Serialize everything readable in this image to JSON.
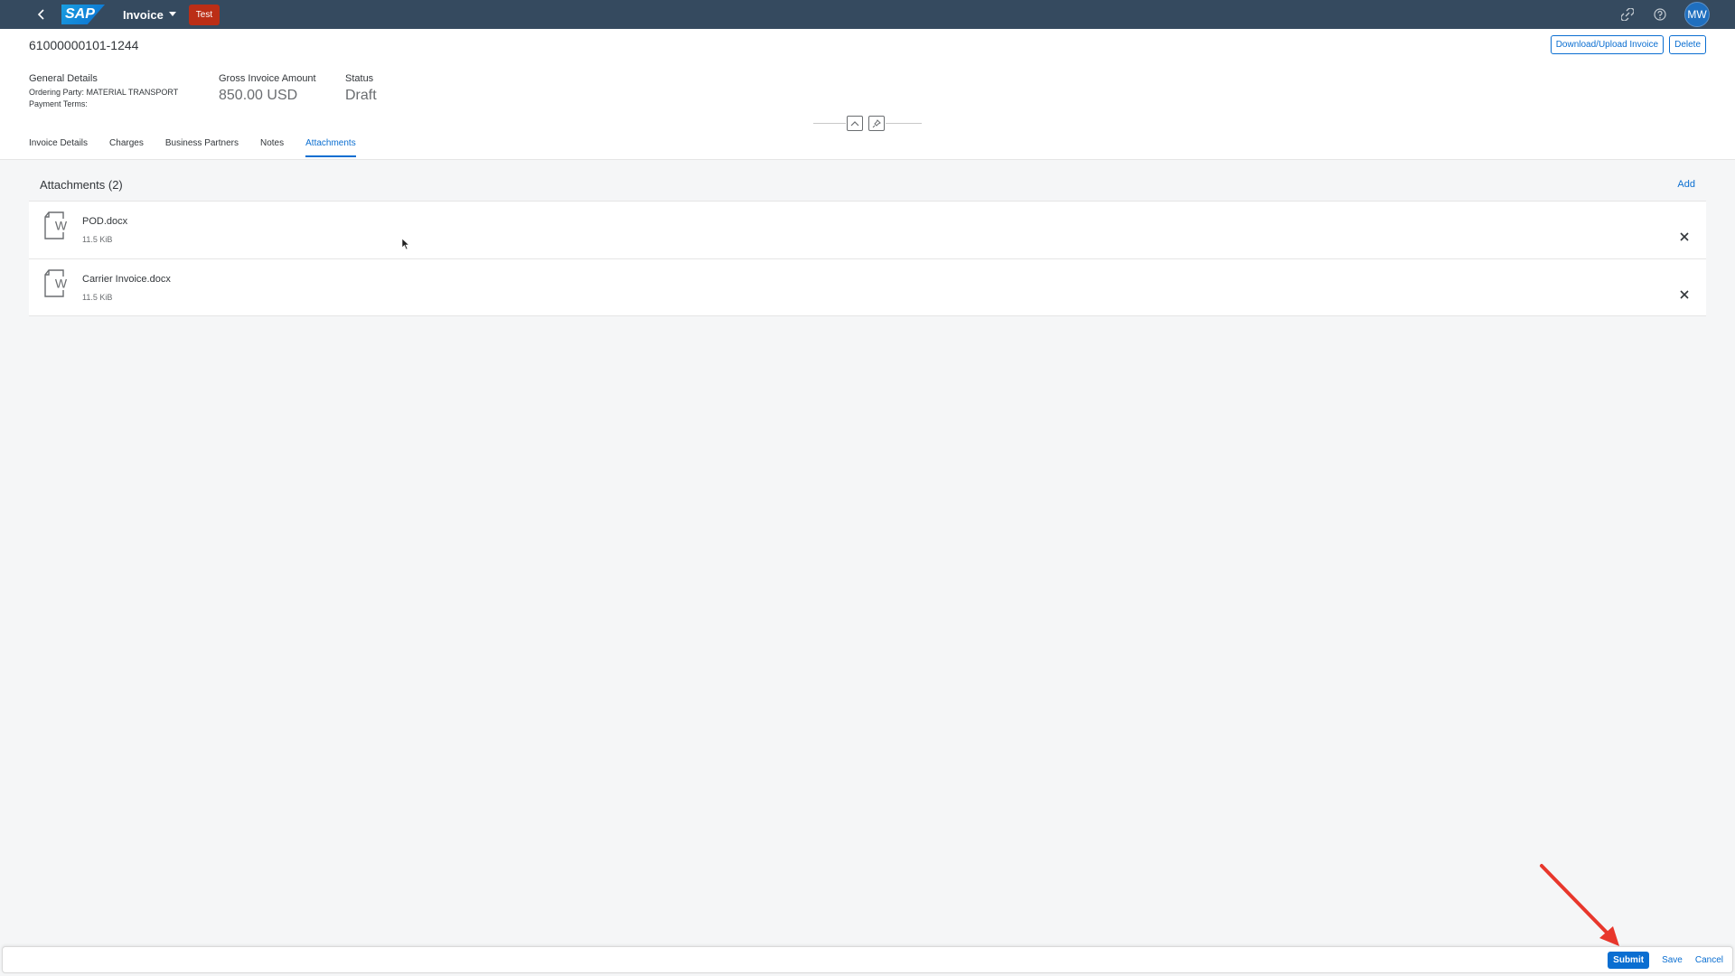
{
  "shell": {
    "logo_text": "SAP",
    "app_title": "Invoice",
    "badge": "Test",
    "avatar_initials": "MW",
    "icons": [
      "back-icon",
      "link-icon",
      "help-icon"
    ],
    "brand_color": "#354a5f",
    "badge_color": "#bb2e16"
  },
  "header": {
    "object_id": "61000000101-1244",
    "buttons": {
      "download_upload": "Download/Upload Invoice",
      "delete": "Delete"
    },
    "general_details": {
      "label": "General Details",
      "ordering_party": "Ordering Party: MATERIAL TRANSPORT",
      "payment_terms": "Payment Terms:"
    },
    "gross_amount": {
      "label": "Gross Invoice Amount",
      "value": "850.00 USD"
    },
    "status": {
      "label": "Status",
      "value": "Draft"
    }
  },
  "tabs": [
    {
      "label": "Invoice Details",
      "active": false
    },
    {
      "label": "Charges",
      "active": false
    },
    {
      "label": "Business Partners",
      "active": false
    },
    {
      "label": "Notes",
      "active": false
    },
    {
      "label": "Attachments",
      "active": true
    }
  ],
  "attachments": {
    "title": "Attachments (2)",
    "add_label": "Add",
    "items": [
      {
        "name": "POD.docx",
        "size": "11.5 KiB",
        "icon": "word-document-icon"
      },
      {
        "name": "Carrier Invoice.docx",
        "size": "11.5 KiB",
        "icon": "word-document-icon"
      }
    ]
  },
  "footer": {
    "submit": "Submit",
    "save": "Save",
    "cancel": "Cancel",
    "accent_color": "#0a6ed1"
  },
  "annotation": {
    "arrow_color": "#e8372c"
  }
}
